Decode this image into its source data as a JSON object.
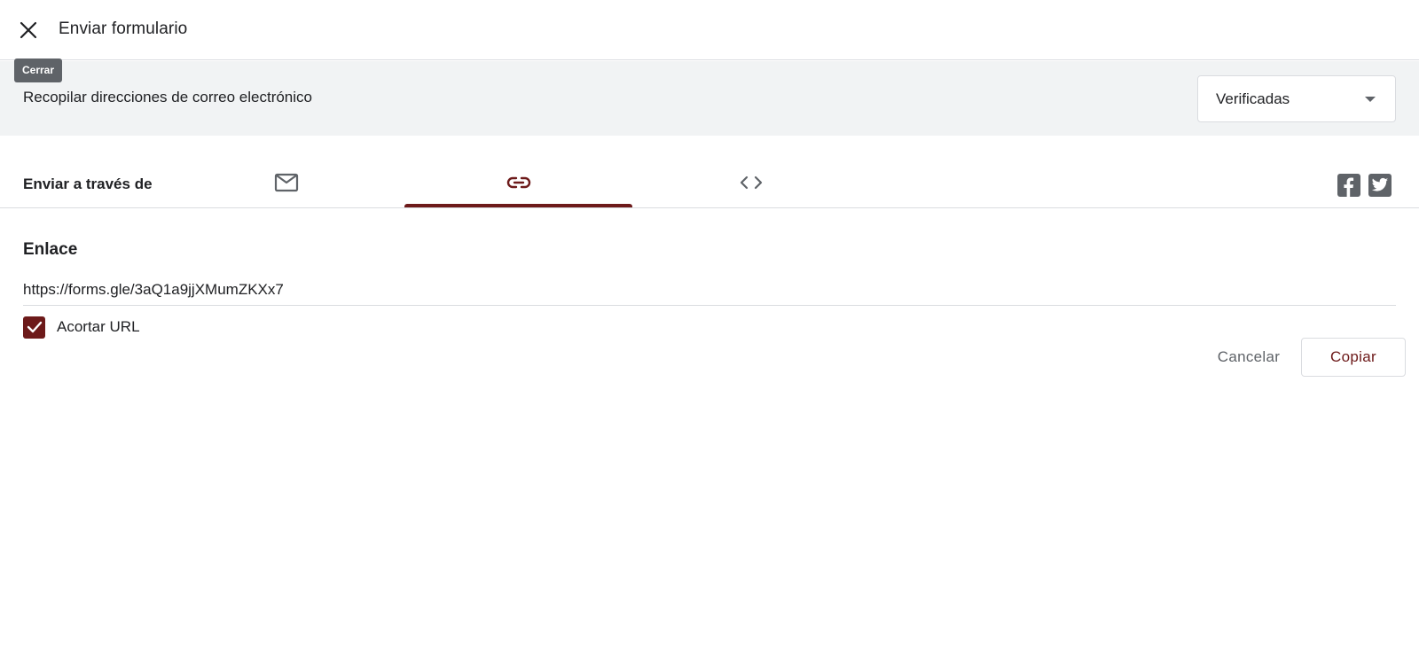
{
  "header": {
    "title": "Enviar formulario",
    "close_icon": "close-icon",
    "close_tooltip": "Cerrar"
  },
  "collect": {
    "label": "Recopilar direcciones de correo electrónico",
    "selected": "Verificadas",
    "dropdown_icon": "caret-down-icon"
  },
  "send": {
    "label": "Enviar a través de",
    "tabs": [
      {
        "icon": "email-icon",
        "active": false
      },
      {
        "icon": "link-icon",
        "active": true
      },
      {
        "icon": "embed-code-icon",
        "active": false
      }
    ],
    "social": [
      {
        "icon": "facebook-icon"
      },
      {
        "icon": "twitter-icon"
      }
    ]
  },
  "link": {
    "title": "Enlace",
    "url": "https://forms.gle/3aQ1a9jjXMumZKXx7",
    "shorten_label": "Acortar URL",
    "shorten_checked": true
  },
  "actions": {
    "cancel_label": "Cancelar",
    "copy_label": "Copiar"
  },
  "colors": {
    "accent": "#6d1a1a",
    "band_background": "#f1f3f4",
    "divider": "#dadce0",
    "icon_gray": "#5f6368"
  }
}
